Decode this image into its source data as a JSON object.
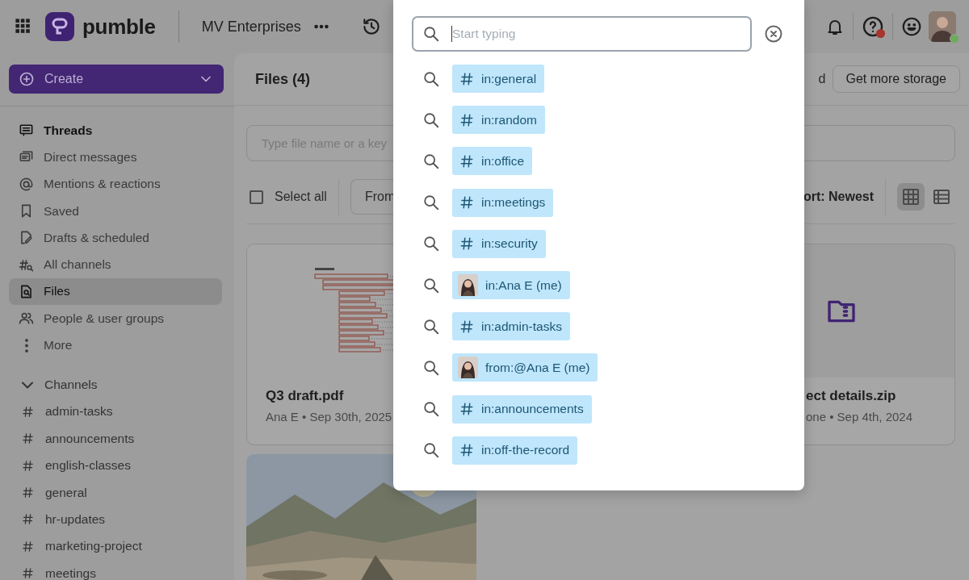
{
  "topbar": {
    "brand": "pumble",
    "workspace": "MV Enterprises"
  },
  "sidebar": {
    "create": "Create",
    "nav": [
      {
        "kind": "threads",
        "label": "Threads",
        "unread": true,
        "selected": false
      },
      {
        "kind": "dm",
        "label": "Direct messages",
        "unread": false,
        "selected": false
      },
      {
        "kind": "mentions",
        "label": "Mentions & reactions",
        "unread": false,
        "selected": false
      },
      {
        "kind": "saved",
        "label": "Saved",
        "unread": false,
        "selected": false
      },
      {
        "kind": "drafts",
        "label": "Drafts & scheduled",
        "unread": false,
        "selected": false
      },
      {
        "kind": "channels",
        "label": "All channels",
        "unread": false,
        "selected": false
      },
      {
        "kind": "files",
        "label": "Files",
        "unread": false,
        "selected": true
      },
      {
        "kind": "people",
        "label": "People & user groups",
        "unread": false,
        "selected": false
      },
      {
        "kind": "more",
        "label": "More",
        "unread": false,
        "selected": false
      }
    ],
    "channels": {
      "title": "Channels",
      "expanded": true,
      "items": [
        "admin-tasks",
        "announcements",
        "english-classes",
        "general",
        "hr-updates",
        "marketing-project",
        "meetings"
      ]
    }
  },
  "main": {
    "title": "Files (4)",
    "storage_note": "d",
    "storage_button": "Get more storage",
    "search": {
      "placeholder": "Type file name or a key"
    },
    "select_all": {
      "label": "Select all",
      "checked": false
    },
    "filter": "From",
    "sort": "ort: Newest",
    "views": [
      {
        "kind": "grid",
        "selected": true
      },
      {
        "kind": "list",
        "selected": false
      }
    ],
    "files": [
      {
        "kind": "pdf",
        "name": "Q3 draft.pdf",
        "meta": "Ana E • Sep 30th, 2025"
      },
      {
        "kind": "folder",
        "name": "ect details.zip",
        "meta": "one • Sep 4th, 2024"
      },
      {
        "kind": "picture"
      }
    ]
  },
  "popup": {
    "search": {
      "placeholder": "Start typing"
    },
    "suggestions": [
      {
        "kind": "channel",
        "label": "in:general"
      },
      {
        "kind": "channel",
        "label": "in:random"
      },
      {
        "kind": "channel",
        "label": "in:office"
      },
      {
        "kind": "channel",
        "label": "in:meetings"
      },
      {
        "kind": "channel",
        "label": "in:security"
      },
      {
        "kind": "person",
        "label": "in:Ana E (me)"
      },
      {
        "kind": "channel",
        "label": "in:admin-tasks"
      },
      {
        "kind": "person",
        "label": "from:@Ana E (me)"
      },
      {
        "kind": "channel",
        "label": "in:announcements"
      },
      {
        "kind": "channel",
        "label": "in:off-the-record"
      }
    ]
  }
}
